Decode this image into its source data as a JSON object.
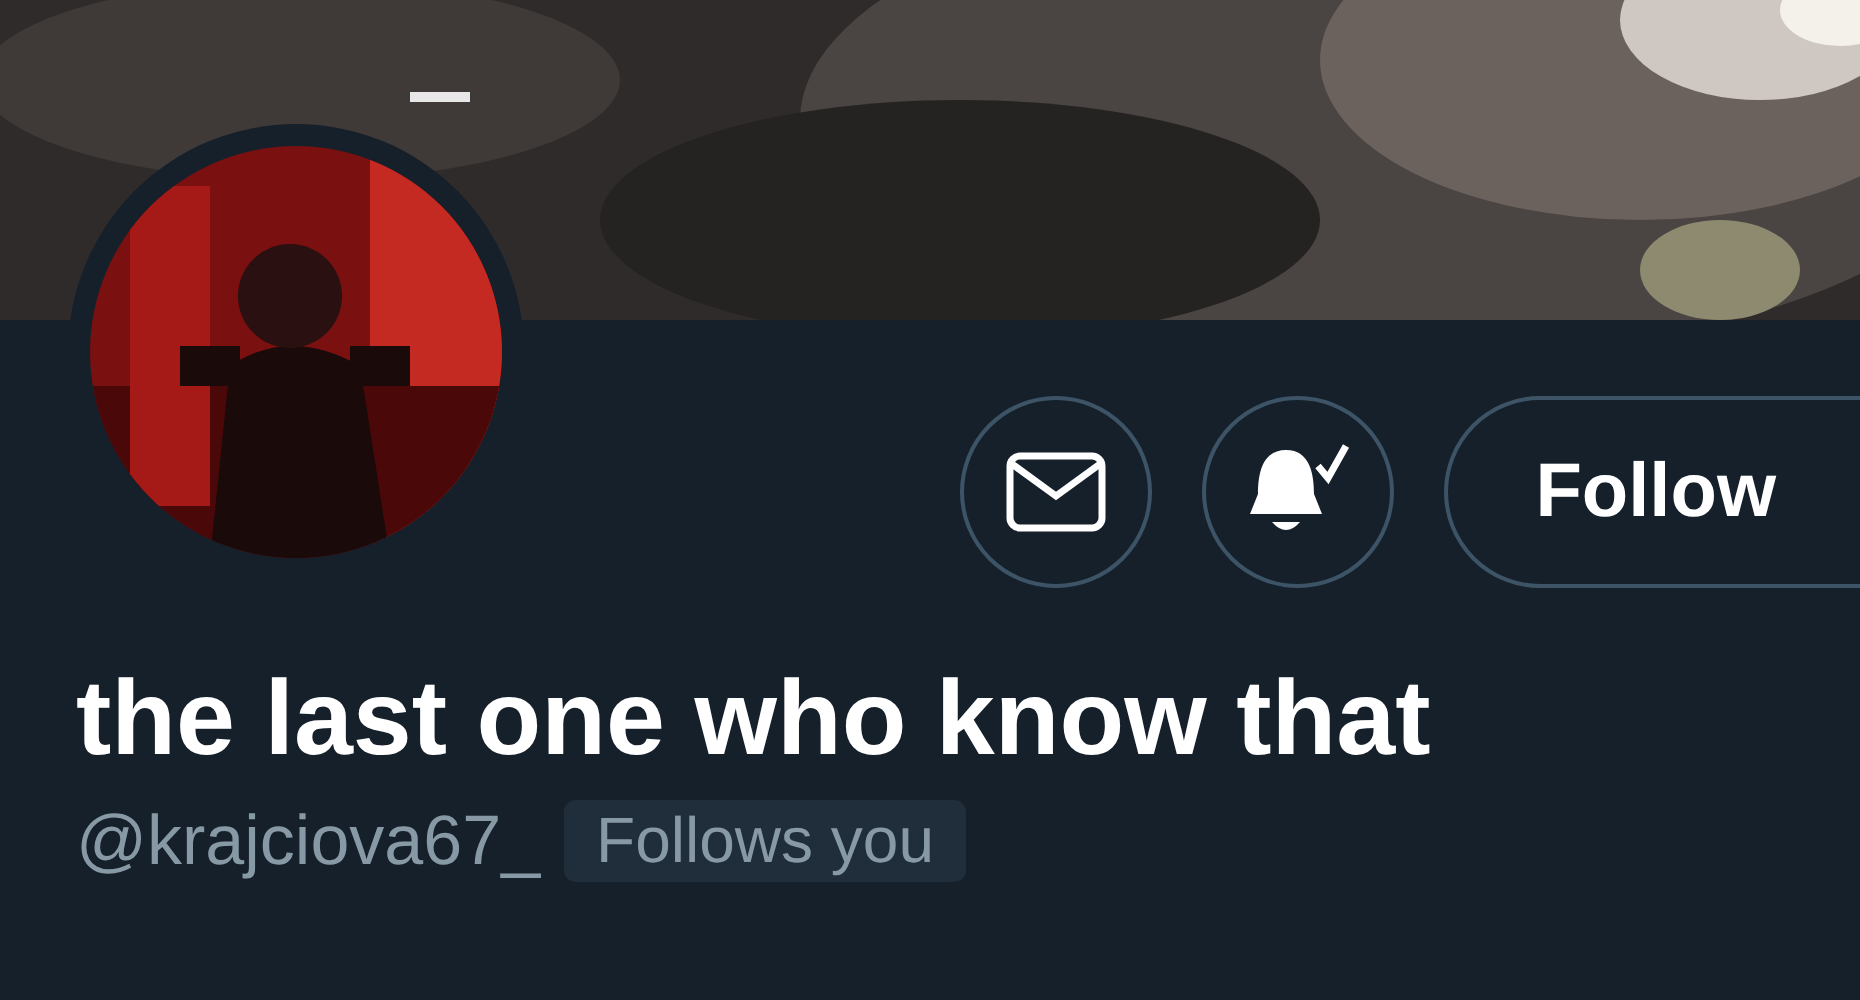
{
  "actions": [
    {
      "kind": "message"
    },
    {
      "kind": "notify"
    },
    {
      "kind": "follow",
      "label": "Follow"
    }
  ],
  "profile": {
    "name": "the last one who know that",
    "handle": "@krajciova67_",
    "badge": "Follows you"
  }
}
